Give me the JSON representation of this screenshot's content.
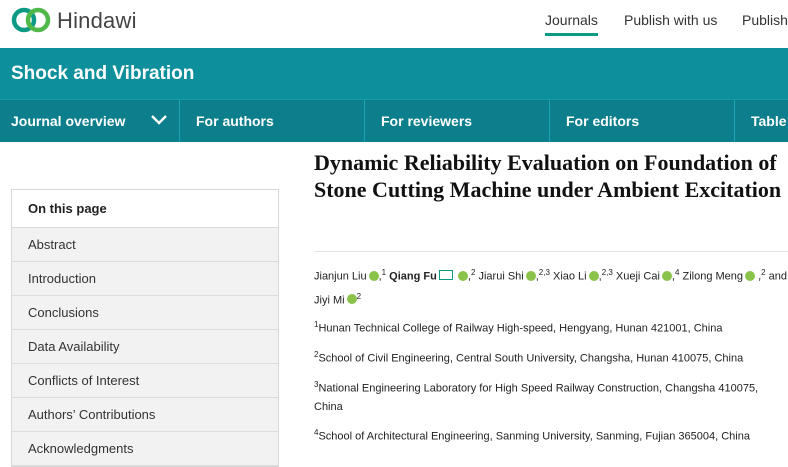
{
  "brand": {
    "name": "Hindawi",
    "accent": "#0d9a84"
  },
  "topnav": [
    "Journals",
    "Publish with us",
    "Publish"
  ],
  "journal": {
    "title": "Shock and Vibration",
    "color": "#0e8f9c"
  },
  "subnav": [
    "Journal overview",
    "For authors",
    "For reviewers",
    "For editors",
    "Table"
  ],
  "sidebar": {
    "heading": "On this page",
    "items": [
      "Abstract",
      "Introduction",
      "Conclusions",
      "Data Availability",
      "Conflicts of Interest",
      "Authors’ Contributions",
      "Acknowledgments"
    ]
  },
  "article": {
    "title": "Dynamic Reliability Evaluation on Foundation of Stone Cutting Machine under Ambient Excitation",
    "authors": [
      {
        "name": "Jianjun Liu",
        "sup": "1"
      },
      {
        "name": "Qiang Fu",
        "sup": "2"
      },
      {
        "name": "Jiarui Shi",
        "sup": "2,3"
      },
      {
        "name": "Xiao Li",
        "sup": "2,3"
      },
      {
        "name": "Xueji Cai",
        "sup": "4"
      },
      {
        "name": "Zilong Meng",
        "sup": "2"
      },
      {
        "name": "Jiyi Mi",
        "sup": "2"
      }
    ],
    "and": "and",
    "affiliations": [
      {
        "num": "1",
        "text": "Hunan Technical College of Railway High-speed, Hengyang, Hunan 421001, China"
      },
      {
        "num": "2",
        "text": "School of Civil Engineering, Central South University, Changsha, Hunan 410075, China"
      },
      {
        "num": "3",
        "text": "National Engineering Laboratory for High Speed Railway Construction, Changsha 410075, China"
      },
      {
        "num": "4",
        "text": "School of Architectural Engineering, Sanming University, Sanming, Fujian 365004, China"
      }
    ]
  }
}
